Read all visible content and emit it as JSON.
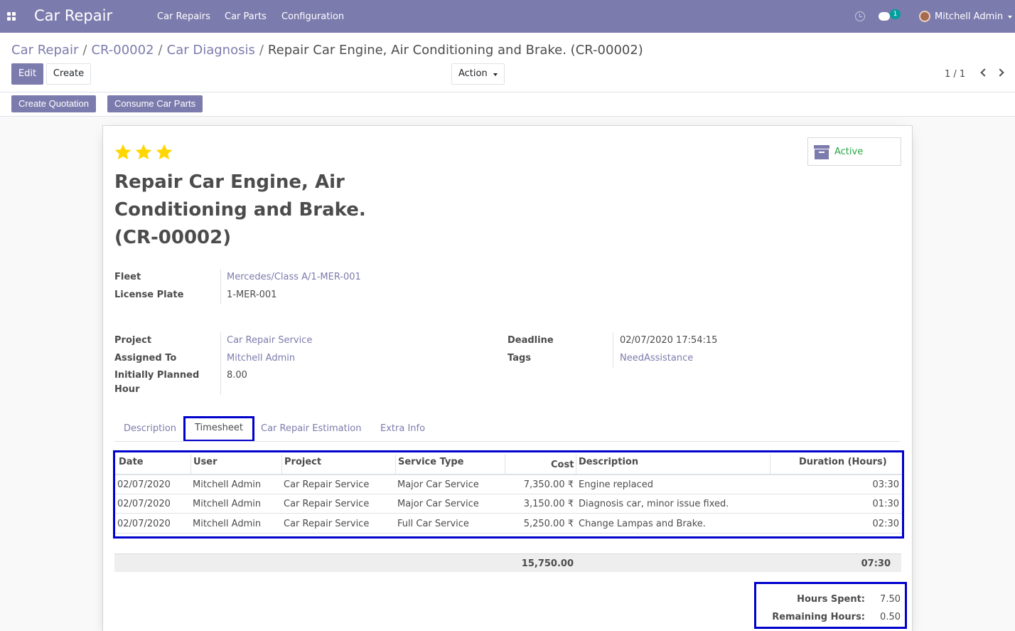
{
  "app": {
    "name": "Car Repair"
  },
  "navbar": {
    "menu": [
      "Car Repairs",
      "Car Parts",
      "Configuration"
    ],
    "chat_badge": "1",
    "user_name": "Mitchell Admin"
  },
  "breadcrumb": [
    "Car Repair",
    "CR-00002",
    "Car Diagnosis",
    "Repair Car Engine, Air Conditioning and Brake. (CR-00002)"
  ],
  "buttons": {
    "edit": "Edit",
    "create": "Create",
    "action": "Action",
    "create_quotation": "Create Quotation",
    "consume_parts": "Consume Car Parts"
  },
  "pager": {
    "value": "1 / 1"
  },
  "record": {
    "stars": 3,
    "status": "Active",
    "title": "Repair Car Engine, Air Conditioning and Brake. (CR-00002)",
    "fields": {
      "fleet": {
        "label": "Fleet",
        "value": "Mercedes/Class A/1-MER-001"
      },
      "license_plate": {
        "label": "License Plate",
        "value": "1-MER-001"
      },
      "project": {
        "label": "Project",
        "value": "Car Repair Service"
      },
      "assigned_to": {
        "label": "Assigned To",
        "value": "Mitchell Admin"
      },
      "planned_hours": {
        "label": "Initially Planned Hour",
        "value": "8.00"
      },
      "deadline": {
        "label": "Deadline",
        "value": "02/07/2020 17:54:15"
      },
      "tags": {
        "label": "Tags",
        "value": "NeedAssistance"
      }
    }
  },
  "tabs": [
    "Description",
    "Timesheet",
    "Car Repair Estimation",
    "Extra Info"
  ],
  "timesheet": {
    "columns": [
      "Date",
      "User",
      "Project",
      "Service Type",
      "Cost",
      "Description",
      "Duration (Hours)"
    ],
    "rows": [
      [
        "02/07/2020",
        "Mitchell Admin",
        "Car Repair Service",
        "Major Car Service",
        "7,350.00 ₹",
        "Engine replaced",
        "03:30"
      ],
      [
        "02/07/2020",
        "Mitchell Admin",
        "Car Repair Service",
        "Major Car Service",
        "3,150.00 ₹",
        "Diagnosis car, minor issue fixed.",
        "01:30"
      ],
      [
        "02/07/2020",
        "Mitchell Admin",
        "Car Repair Service",
        "Full Car Service",
        "5,250.00 ₹",
        "Change Lampas and Brake.",
        "02:30"
      ]
    ],
    "total_cost": "15,750.00",
    "total_duration": "07:30"
  },
  "summary": {
    "hours_spent_label": "Hours Spent:",
    "hours_spent": "7.50",
    "remaining_label": "Remaining Hours:",
    "remaining": "0.50"
  },
  "colors": {
    "brand": "#7c7bad",
    "highlight": "#0000cd",
    "active": "#28a745",
    "star": "#ffd700"
  }
}
